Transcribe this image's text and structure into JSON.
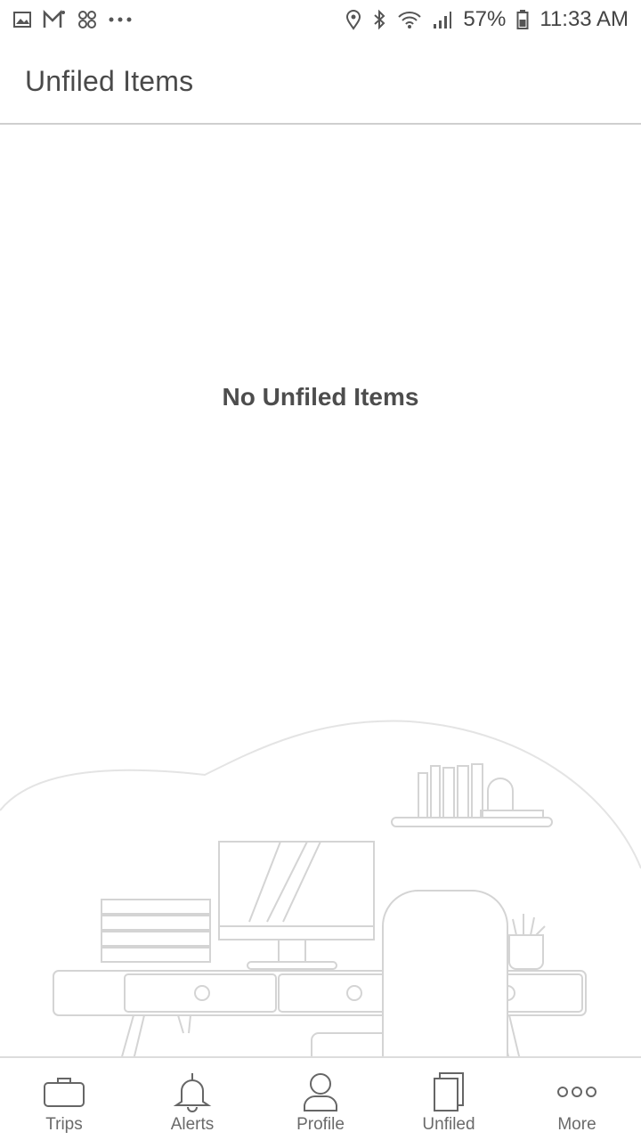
{
  "status_bar": {
    "battery_percent": "57%",
    "time": "11:33 AM",
    "icons_left": [
      "gallery-icon",
      "gmail-icon",
      "pinwheel-icon",
      "more-dots-icon"
    ],
    "icons_right": [
      "location-icon",
      "bluetooth-icon",
      "wifi-icon",
      "signal-icon",
      "battery-icon"
    ]
  },
  "header": {
    "title": "Unfiled Items"
  },
  "main": {
    "empty_message": "No Unfiled Items"
  },
  "bottom_nav": {
    "items": [
      {
        "label": "Trips",
        "icon": "suitcase-icon"
      },
      {
        "label": "Alerts",
        "icon": "bell-icon"
      },
      {
        "label": "Profile",
        "icon": "person-icon"
      },
      {
        "label": "Unfiled",
        "icon": "documents-icon"
      },
      {
        "label": "More",
        "icon": "more-circles-icon"
      }
    ]
  },
  "colors": {
    "line_gray": "#cfcfcf",
    "text_dark": "#4a4a4a",
    "text_muted": "#6a6a6a",
    "illustration_stroke": "#d2d2d2"
  }
}
